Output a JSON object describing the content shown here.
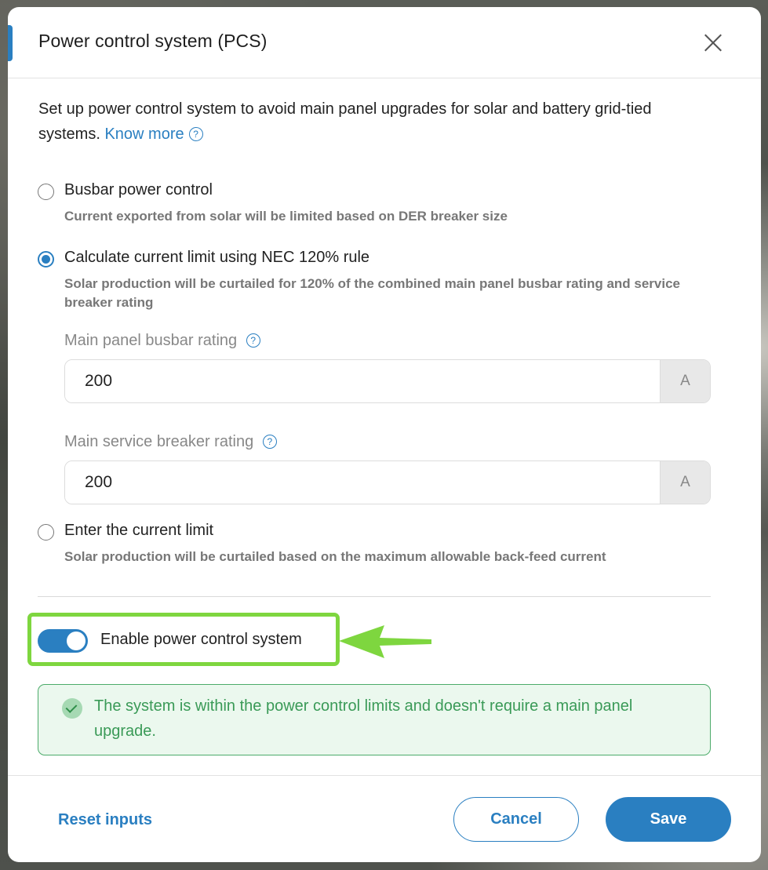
{
  "dialog": {
    "title": "Power control system (PCS)",
    "close_icon": "close-icon"
  },
  "intro": {
    "text": "Set up power control system to avoid main panel upgrades for solar and battery grid-tied systems.",
    "link_label": "Know more",
    "help_icon": "?"
  },
  "options": [
    {
      "label": "Busbar power control",
      "description": "Current exported from solar will be limited based on DER breaker size",
      "selected": false
    },
    {
      "label": "Calculate current limit using NEC 120% rule",
      "description": "Solar production will be curtailed for 120% of the combined main panel busbar rating and service breaker rating",
      "selected": true
    },
    {
      "label": "Enter the current limit",
      "description": "Solar production will be curtailed based on the maximum allowable back-feed current",
      "selected": false
    }
  ],
  "fields": {
    "busbar": {
      "label": "Main panel busbar rating",
      "value": "200",
      "unit": "A",
      "help": "?"
    },
    "breaker": {
      "label": "Main service breaker rating",
      "value": "200",
      "unit": "A",
      "help": "?"
    }
  },
  "toggle": {
    "label": "Enable power control system",
    "on": true
  },
  "status": {
    "text": "The system is within the power control limits and doesn't require a main panel upgrade.",
    "icon": "check-circle-icon"
  },
  "footer": {
    "reset_label": "Reset inputs",
    "cancel_label": "Cancel",
    "save_label": "Save"
  },
  "colors": {
    "accent": "#2a7fc1",
    "highlight": "#7ed63f",
    "success": "#3a9a57"
  }
}
